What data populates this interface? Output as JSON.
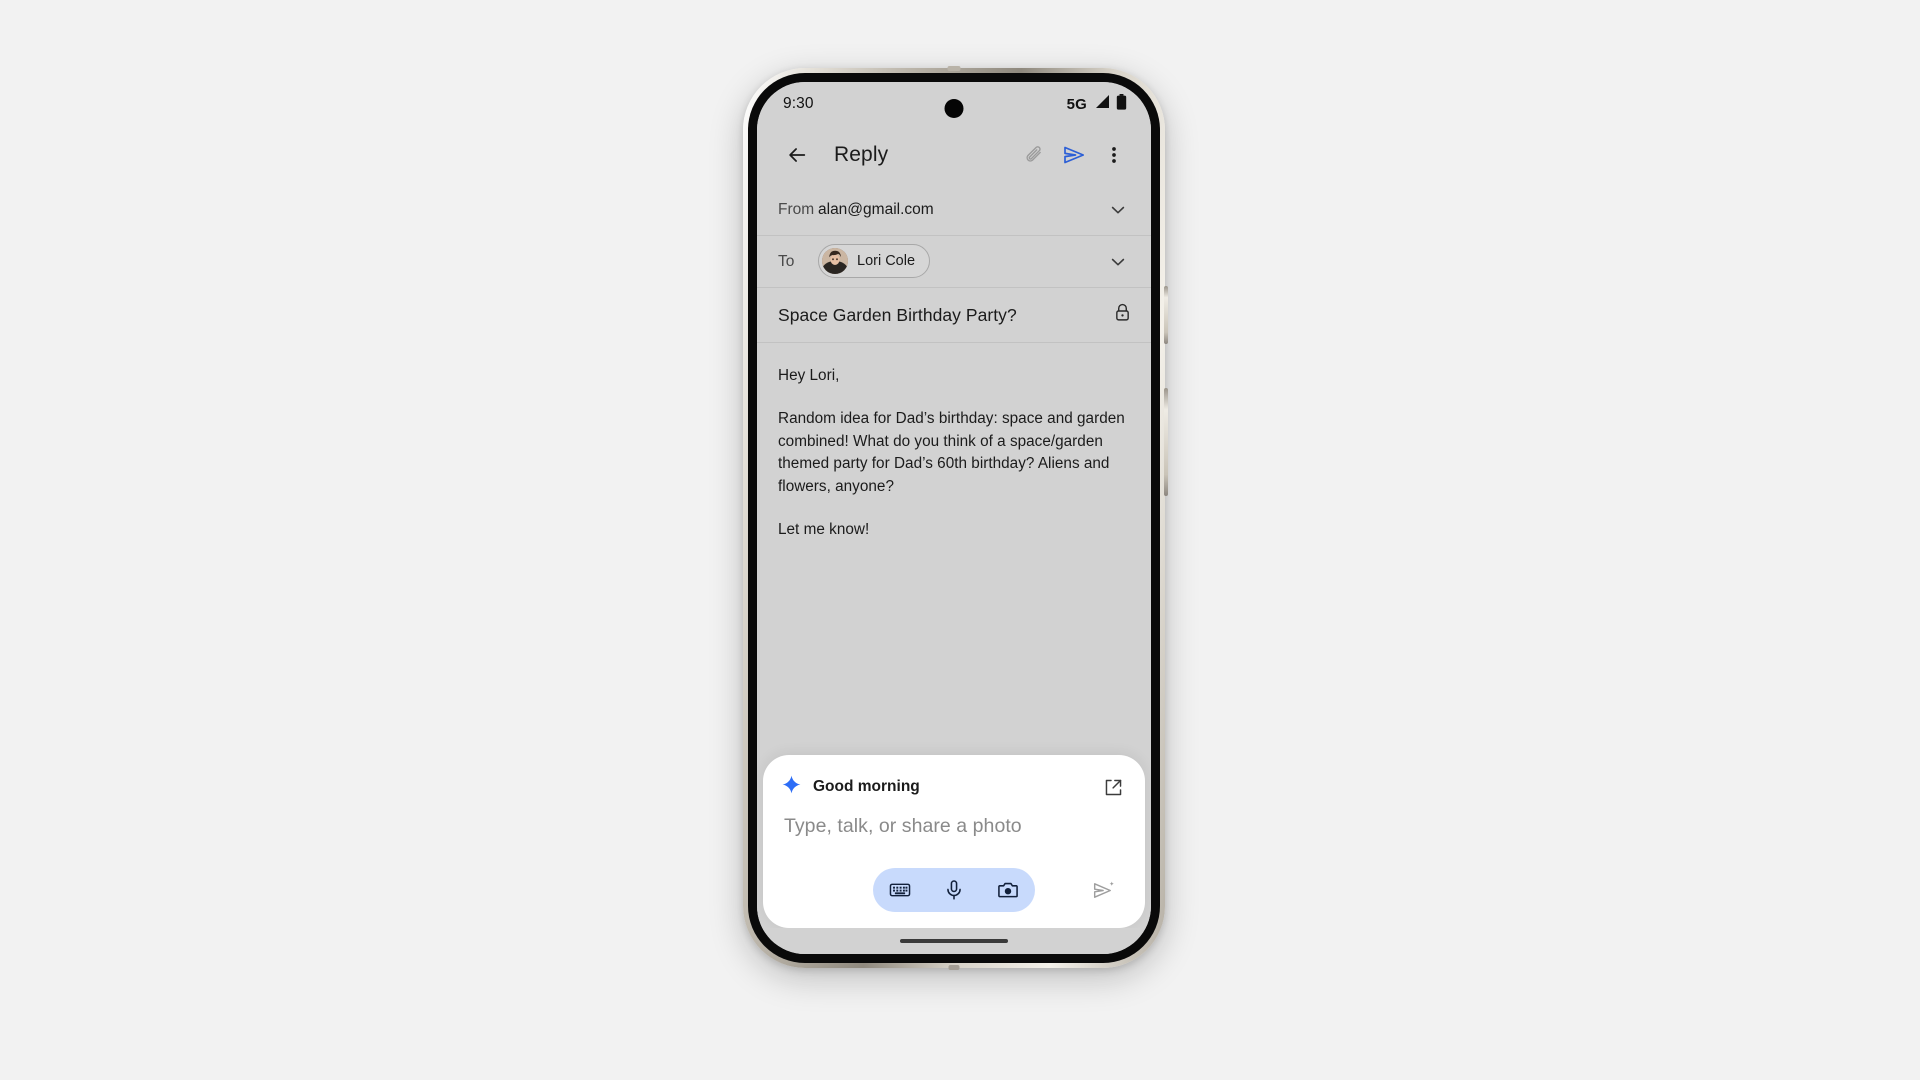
{
  "status_bar": {
    "time": "9:30",
    "network": "5G",
    "signal_icon": "signal-bars-icon",
    "battery_icon": "battery-full-icon",
    "camera_icon": "front-camera-punch-hole"
  },
  "app_bar": {
    "back_icon": "arrow-back-icon",
    "title": "Reply",
    "attach_icon": "paperclip-icon",
    "send_icon": "send-icon",
    "overflow_icon": "more-vert-icon",
    "send_color": "#2c5fd6"
  },
  "compose": {
    "from": {
      "label": "From",
      "value": "alan@gmail.com",
      "chevron_icon": "chevron-down-icon"
    },
    "to": {
      "label": "To",
      "recipient": "Lori Cole",
      "avatar_icon": "contact-avatar",
      "chevron_icon": "chevron-down-icon"
    },
    "subject": {
      "value": "Space Garden Birthday Party?",
      "lock_icon": "lock-icon"
    },
    "body": [
      "Hey Lori,",
      "Random idea for Dad’s birthday: space and garden combined! What do you think of a space/garden themed party for Dad’s 60th birthday? Aliens and flowers, anyone?",
      "Let me know!"
    ]
  },
  "gemini_card": {
    "sparkle_icon": "gemini-sparkle-icon",
    "greeting": "Good morning",
    "expand_icon": "open-in-new-icon",
    "input_placeholder": "Type, talk, or share a photo",
    "actions": [
      {
        "icon": "keyboard-icon",
        "label": "Keyboard"
      },
      {
        "icon": "microphone-icon",
        "label": "Microphone"
      },
      {
        "icon": "camera-icon",
        "label": "Camera"
      }
    ],
    "send_icon": "send-sparkle-icon",
    "pill_color": "#c8dafc",
    "sparkle_color": "#2d6df6"
  },
  "system": {
    "home_indicator": "home-gesture-bar"
  }
}
